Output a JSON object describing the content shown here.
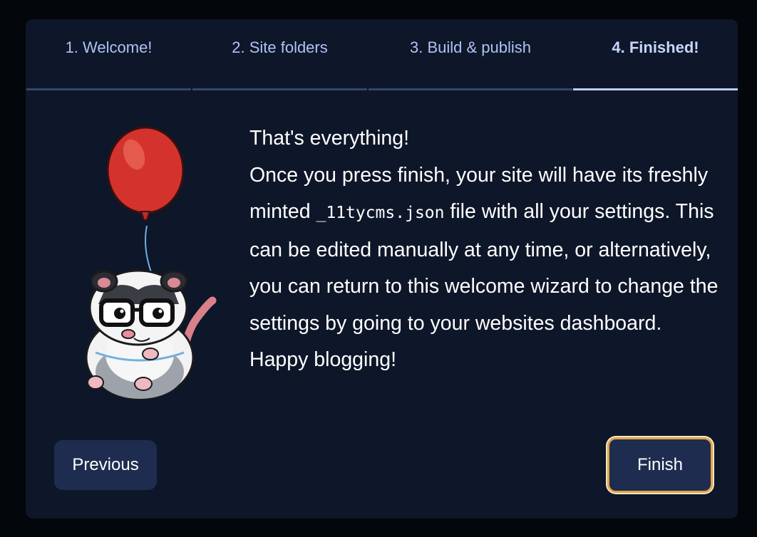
{
  "tabs": [
    {
      "label": "1. Welcome!",
      "active": false
    },
    {
      "label": "2. Site folders",
      "active": false
    },
    {
      "label": "3. Build & publish",
      "active": false
    },
    {
      "label": "4. Finished!",
      "active": true
    }
  ],
  "illustration": {
    "name": "opossum-with-red-balloon"
  },
  "message": {
    "heading": "That's everything!",
    "body_before_code": "Once you press finish, your site will have its freshly minted ",
    "code": "_11tycms.json",
    "body_after_code": " file with all your settings. This can be edited manually at any time, or alternatively, you can return to this welcome wizard to change the settings by going to your websites dashboard.",
    "closing": "Happy blogging!"
  },
  "buttons": {
    "previous": "Previous",
    "finish": "Finish"
  },
  "colors": {
    "background": "#03060b",
    "dialog": "#0e1629",
    "tab_text": "#aec4f3",
    "active_underline": "#b9cdf6",
    "button": "#1e2c4f",
    "focus_ring": "#e0a64a",
    "balloon": "#d4332d"
  }
}
